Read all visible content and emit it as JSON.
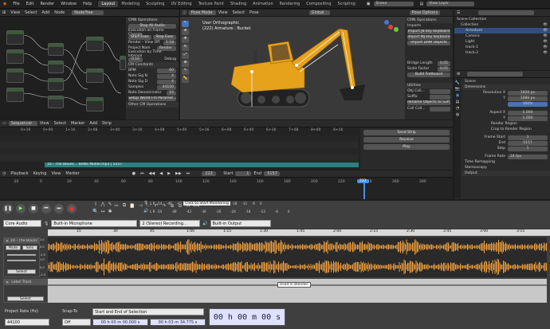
{
  "topbar": {
    "menus": [
      "File",
      "Edit",
      "Render",
      "Window",
      "Help"
    ],
    "workspaces": [
      "Layout",
      "Modeling",
      "Sculpting",
      "UV Editing",
      "Texture Paint",
      "Shading",
      "Animation",
      "Rendering",
      "Compositing",
      "Scripting"
    ],
    "active_workspace": "Layout",
    "scene": "Scene",
    "view_layer": "View Layer"
  },
  "node_editor": {
    "menus": [
      "View",
      "Select",
      "Add",
      "Node"
    ],
    "tree_name": "NodeTree",
    "panel": {
      "title": "CMN Operations",
      "stop_btn": "Stop All Audio",
      "exec_label": "Execution on Frame Change",
      "start_exec": "Start Exec",
      "stop_exec": "Stop Exec",
      "render_label": "Render - View Off",
      "render_val": "1:18",
      "project_label": "Project Nam",
      "project_val": "Render",
      "exec_time_label": "Execution by Time Interval",
      "time_val": "0.10",
      "debug": "Debug",
      "cm_constants": "CM Constants",
      "bpm_label": "BPM",
      "bpm_val": "60",
      "note_sig_n_label": "Note Sig N",
      "note_sig_n_val": "4",
      "note_sig_d_label": "Note Sig D",
      "note_sig_d_val": "4",
      "samples_label": "Samples",
      "samples_val": "44100",
      "note_den_label": "Note Denominator",
      "note_den_val": "16",
      "setup_btn": "Setup World Fm Paramet...",
      "other_label": "Other CM Operations"
    }
  },
  "viewport": {
    "mode": "Pose Mode",
    "menus": [
      "View",
      "Select",
      "Pose"
    ],
    "orientation": "Global",
    "options": "Pose Options",
    "info1": "User Orthographic",
    "info2": "(222) Armature : Bucket",
    "side_panel": {
      "title": "CMN Operations",
      "imports": "Imports",
      "btn1": "Import JB key keyboard",
      "btn2": "Import MJ key keyboard",
      "btn3": "Import DAW Objects",
      "bridge_label": "Bridge Length",
      "bridge_val": "0.05",
      "scale_label": "Scale Factor",
      "scale_val": "0.05",
      "build_btn": "Build Fretboard",
      "utilities": "Utilities",
      "obj_coll": "Obj Coll...",
      "suffix": "Suffix",
      "rename_btn": "Rename Objects to Suff...",
      "coll_coll": "Coll Coll..."
    }
  },
  "outliner": {
    "title": "Scene Collection",
    "items": [
      "Collection",
      "Armature",
      "Camera",
      "Light",
      "track-1",
      "track-2"
    ]
  },
  "properties": {
    "scene": "Scene",
    "dimensions": "Dimensions",
    "res_x_label": "Resolution X",
    "res_x": "1920 px",
    "res_y_label": "Y",
    "res_y": "1080 px",
    "res_pct": "100%",
    "aspect_x_label": "Aspect X",
    "aspect_x": "1.000",
    "aspect_y_label": "Y",
    "aspect_y": "1.000",
    "render_region": "Render Region",
    "crop": "Crop to Render Region",
    "frame_start_label": "Frame Start",
    "frame_start": "1",
    "end_label": "End",
    "end": "5157",
    "step_label": "Step",
    "step": "1",
    "frame_rate_label": "Frame Rate",
    "frame_rate": "24 fps",
    "time_remap": "Time Remapping",
    "stereo": "Stereoscopy",
    "output": "Output"
  },
  "sequencer": {
    "title": "Sequencer",
    "menus": [
      "View",
      "Select",
      "Marker",
      "Add",
      "Strip"
    ],
    "ruler": [
      "0+16",
      "0+00",
      "1+16",
      "2+08",
      "3+00",
      "3+16",
      "4+08",
      "5+00",
      "5+16",
      "6+08",
      "6+00",
      "6+16",
      "7+08",
      "8+00",
      "8+16"
    ],
    "strip_label": "10 - The Bounc... Bette Midler.mp3 | 5157",
    "send_btn": "Send Strip",
    "receive_btn": "Receive",
    "play_btn": "Play"
  },
  "timeline": {
    "playback": "Playback",
    "keying": "Keying",
    "menus": [
      "View",
      "Marker"
    ],
    "current_frame": "222",
    "start_label": "Start",
    "start": "1",
    "end_label": "End",
    "end": "5157",
    "ruler": [
      "-20",
      "0",
      "20",
      "40",
      "60",
      "80",
      "100",
      "120",
      "140",
      "160",
      "180",
      "200",
      "220",
      "240",
      "260",
      "280"
    ]
  },
  "audacity": {
    "monitor_text": "Click to Start Monitoring",
    "meter_ticks": [
      "-54",
      "-48",
      "-42",
      "-36",
      "-30",
      "-24",
      "-18",
      "-12",
      "-6",
      "0"
    ],
    "host": "Core Audio",
    "input": "Built-in Microphone",
    "channels": "2 (Stereo) Recording...",
    "output": "Built-in Output",
    "ruler": [
      "15",
      "30",
      "45",
      "1:00",
      "1:15",
      "1:30",
      "1:45",
      "2:00",
      "2:15",
      "2:30",
      "2:45",
      "3:00",
      "3:15",
      "3:30"
    ],
    "track_name": "10 - The Bounc",
    "mute": "Mute",
    "solo": "Solo",
    "select": "Select",
    "label_track": "Label Track",
    "label_text": "Used in Blender",
    "amp_ticks": [
      "1.0",
      "0.0",
      "-1.0"
    ],
    "project_rate_label": "Project Rate (Hz)",
    "project_rate": "44100",
    "snap_label": "Snap-To",
    "snap": "Off",
    "selection_label": "Start and End of Selection",
    "sel_start": "00 h 00 m 00.000 s",
    "sel_end": "00 h 03 m 34.775 s",
    "big_time": "00 h 00 m 00 s"
  }
}
